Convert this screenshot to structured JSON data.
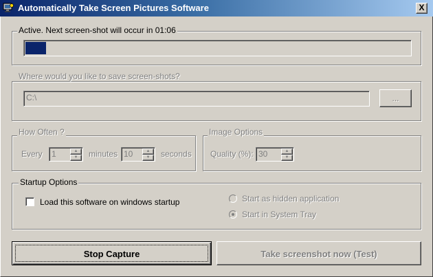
{
  "window": {
    "title": "Automatically Take Screen Pictures Software",
    "close_glyph": "X",
    "app_icon": "camera-monitor-icon"
  },
  "status": {
    "label": "Active. Next screen-shot will occur in 01:06",
    "progress": 0.054
  },
  "save_location": {
    "label": "Where would you like to save screen-shots?",
    "path": "C:\\",
    "browse_label": "..."
  },
  "how_often": {
    "label": "How Often ?",
    "every_label": "Every",
    "minutes_value": "1",
    "minutes_label": "minutes",
    "seconds_value": "10",
    "seconds_label": "seconds"
  },
  "image_options": {
    "label": "Image Options",
    "quality_label": "Quality (%):",
    "quality_value": "30"
  },
  "startup": {
    "label": "Startup Options",
    "load_on_startup_label": "Load this software on windows startup",
    "load_on_startup_checked": false,
    "hidden_label": "Start as hidden application",
    "tray_label": "Start in System Tray",
    "selected": "tray"
  },
  "buttons": {
    "stop": "Stop Capture",
    "test": "Take screenshot now (Test)"
  },
  "colors": {
    "progress_fill": "#0a246a",
    "title_start": "#0a246a",
    "title_end": "#a6caf0",
    "face": "#d4d0c8"
  }
}
